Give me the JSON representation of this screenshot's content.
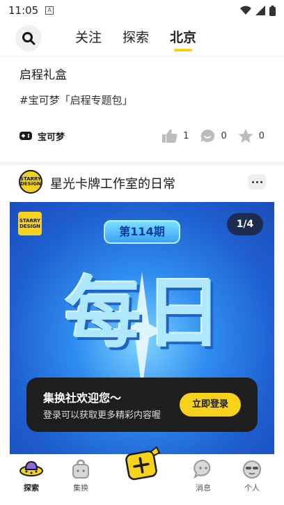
{
  "status": {
    "time": "11:05",
    "a_badge": "A"
  },
  "top_nav": {
    "tabs": [
      {
        "label": "关注"
      },
      {
        "label": "探索"
      },
      {
        "label": "北京"
      }
    ]
  },
  "card1": {
    "title": "启程礼盒",
    "tag": "#宝可梦「启程专题包」",
    "source": "宝可梦",
    "likes": "1",
    "comments": "0",
    "favorites": "0"
  },
  "post": {
    "author": "星光卡牌工作室的日常",
    "avatar_text": "STARRY DESIGN",
    "image": {
      "logo_text": "STARRY DESIGN",
      "issue": "第114期",
      "counter": "1/4",
      "big_text": "每日"
    }
  },
  "toast": {
    "title": "集换社欢迎您～",
    "subtitle": "登录可以获取更多精彩内容喔",
    "button": "立即登录"
  },
  "bottom_nav": {
    "items": [
      {
        "label": "探索"
      },
      {
        "label": "集换"
      },
      {
        "label": "消息"
      },
      {
        "label": "个人"
      }
    ]
  },
  "colors": {
    "accent": "#f7d21a",
    "dark": "#1e1e1e",
    "image_blue": "#2f8df0"
  }
}
